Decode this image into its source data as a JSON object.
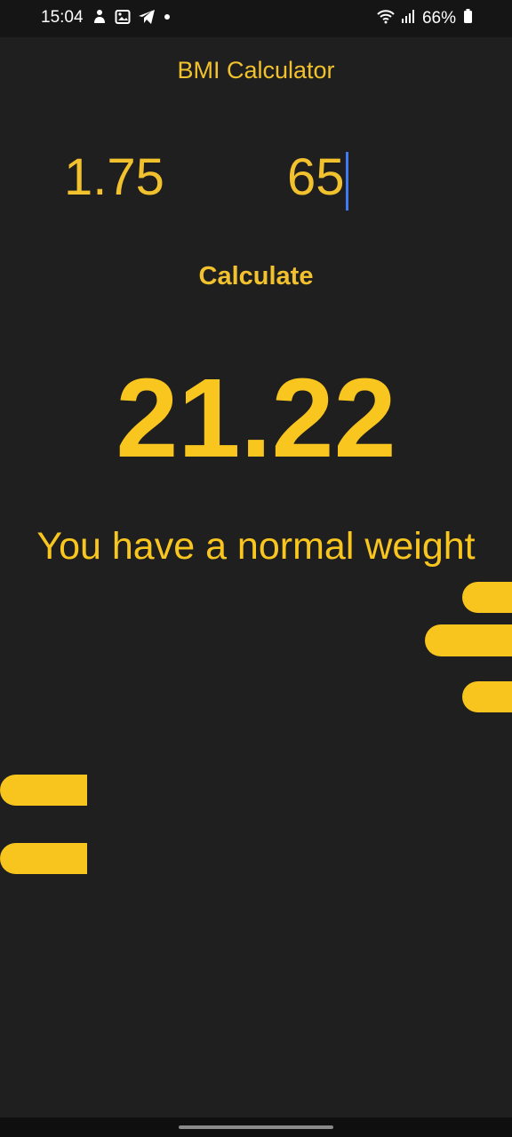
{
  "status_bar": {
    "time": "15:04",
    "left_icons": [
      "notification-icon",
      "image-icon",
      "telegram-icon",
      "dot-icon"
    ],
    "battery_text": "66%"
  },
  "app": {
    "title": "BMI Calculator"
  },
  "inputs": {
    "height_value": "1.75",
    "weight_value": "65"
  },
  "actions": {
    "calculate_label": "Calculate"
  },
  "result": {
    "bmi_value": "21.22",
    "message": "You have a normal weight"
  },
  "colors": {
    "background": "#1f1f1f",
    "accent": "#f2c12e",
    "caret": "#3f7cf3"
  }
}
